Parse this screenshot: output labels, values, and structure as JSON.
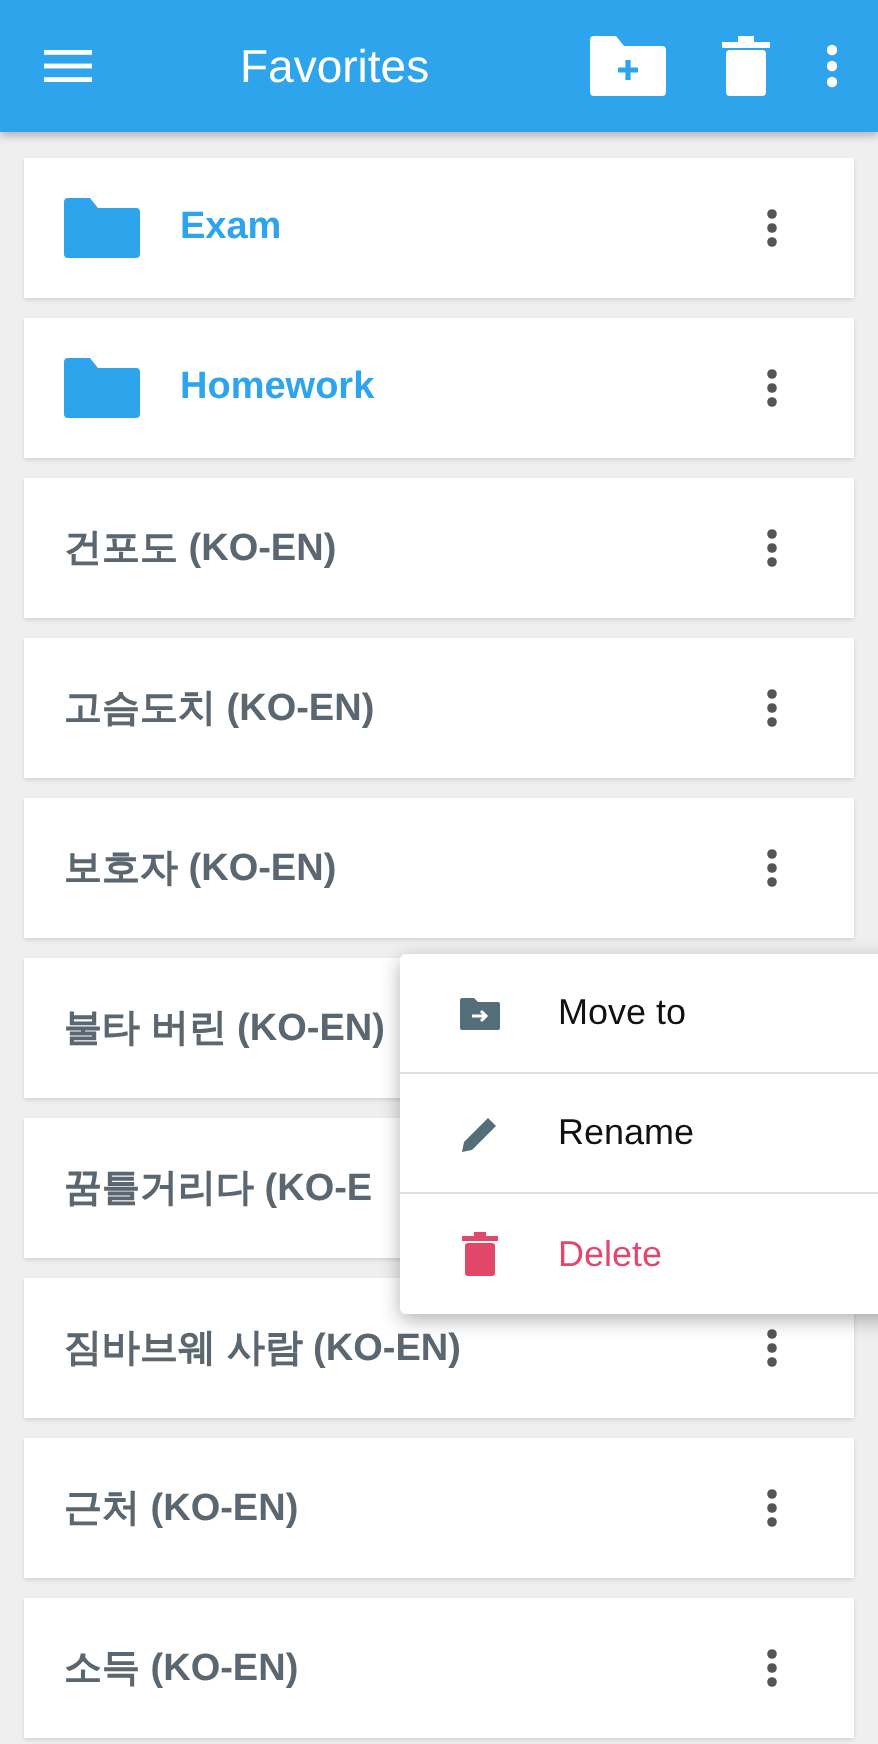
{
  "app_bar": {
    "title": "Favorites"
  },
  "items": [
    {
      "kind": "folder",
      "label": "Exam"
    },
    {
      "kind": "folder",
      "label": "Homework"
    },
    {
      "kind": "entry",
      "label": "건포도 (KO-EN)"
    },
    {
      "kind": "entry",
      "label": "고슴도치 (KO-EN)"
    },
    {
      "kind": "entry",
      "label": "보호자 (KO-EN)"
    },
    {
      "kind": "entry",
      "label": "불타 버린 (KO-EN)"
    },
    {
      "kind": "entry",
      "label": "꿈틀거리다 (KO-E"
    },
    {
      "kind": "entry",
      "label": "짐바브웨 사람 (KO-EN)"
    },
    {
      "kind": "entry",
      "label": "근처 (KO-EN)"
    },
    {
      "kind": "entry",
      "label": "소득 (KO-EN)"
    }
  ],
  "context_menu": {
    "items": [
      {
        "kind": "move",
        "label": "Move to"
      },
      {
        "kind": "rename",
        "label": "Rename"
      },
      {
        "kind": "delete",
        "label": "Delete"
      }
    ]
  }
}
